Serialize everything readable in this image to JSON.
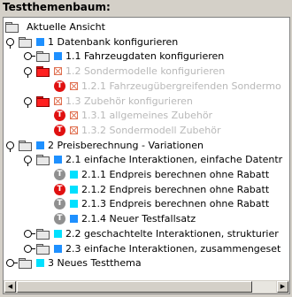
{
  "title": "Testthemenbaum:",
  "tree": [
    {
      "label": "Aktuelle Ansicht",
      "indent": 0,
      "handle": "",
      "folder": "gray",
      "mark": "",
      "tcircle": "",
      "disabled": false
    },
    {
      "label": "1 Datenbank konfigurieren",
      "indent": 0,
      "handle": "open",
      "folder": "gray",
      "mark": "blue",
      "tcircle": "",
      "disabled": false
    },
    {
      "label": "1.1 Fahrzeugdaten konfigurieren",
      "indent": 1,
      "handle": "closed",
      "folder": "gray",
      "mark": "blue",
      "tcircle": "",
      "disabled": false
    },
    {
      "label": "1.2 Sondermodelle konfigurieren",
      "indent": 1,
      "handle": "open",
      "folder": "red",
      "mark": "xbox",
      "tcircle": "",
      "disabled": true
    },
    {
      "label": "1.2.1 Fahrzeugübergreifenden Sondermo",
      "indent": 2,
      "handle": "",
      "folder": "",
      "mark": "xbox",
      "tcircle": "red",
      "disabled": true
    },
    {
      "label": "1.3 Zubehör konfigurieren",
      "indent": 1,
      "handle": "open",
      "folder": "red",
      "mark": "xbox",
      "tcircle": "",
      "disabled": true
    },
    {
      "label": "1.3.1 allgemeines Zubehör",
      "indent": 2,
      "handle": "",
      "folder": "",
      "mark": "xbox",
      "tcircle": "red",
      "disabled": true
    },
    {
      "label": "1.3.2 Sondermodell Zubehör",
      "indent": 2,
      "handle": "",
      "folder": "",
      "mark": "xbox",
      "tcircle": "red",
      "disabled": true
    },
    {
      "label": "2 Preisberechnung - Variationen",
      "indent": 0,
      "handle": "open",
      "folder": "gray",
      "mark": "blue",
      "tcircle": "",
      "disabled": false
    },
    {
      "label": "2.1 einfache Interaktionen, einfache Datentr",
      "indent": 1,
      "handle": "open",
      "folder": "gray",
      "mark": "blue",
      "tcircle": "",
      "disabled": false
    },
    {
      "label": "2.1.1 Endpreis berechnen ohne Rabatt",
      "indent": 2,
      "handle": "",
      "folder": "",
      "mark": "cyan",
      "tcircle": "gray",
      "disabled": false
    },
    {
      "label": "2.1.2 Endpreis berechnen ohne Rabatt",
      "indent": 2,
      "handle": "",
      "folder": "",
      "mark": "cyan",
      "tcircle": "red",
      "disabled": false
    },
    {
      "label": "2.1.3 Endpreis berechnen ohne Rabatt",
      "indent": 2,
      "handle": "",
      "folder": "",
      "mark": "cyan",
      "tcircle": "gray",
      "disabled": false
    },
    {
      "label": "2.1.4 Neuer Testfallsatz",
      "indent": 2,
      "handle": "",
      "folder": "",
      "mark": "blue",
      "tcircle": "gray",
      "disabled": false
    },
    {
      "label": "2.2 geschachtelte Interaktionen, strukturier",
      "indent": 1,
      "handle": "closed",
      "folder": "gray",
      "mark": "cyan",
      "tcircle": "",
      "disabled": false
    },
    {
      "label": "2.3 einfache Interaktionen, zusammengeset",
      "indent": 1,
      "handle": "closed",
      "folder": "gray",
      "mark": "blue",
      "tcircle": "",
      "disabled": false
    },
    {
      "label": "3 Neues Testthema",
      "indent": 0,
      "handle": "closed",
      "folder": "gray",
      "mark": "cyan",
      "tcircle": "",
      "disabled": false
    }
  ]
}
